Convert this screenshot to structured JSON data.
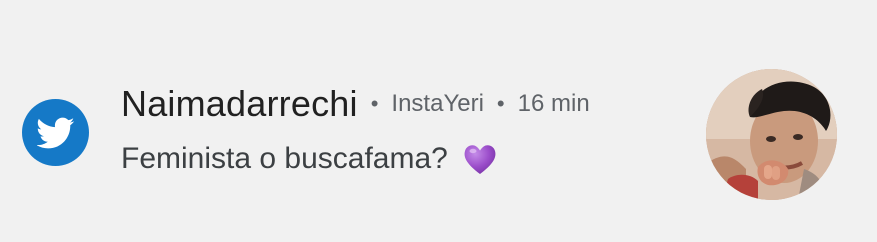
{
  "notification": {
    "app_icon": "twitter-bird-icon",
    "sender": "Naimadarrechi",
    "separator": "•",
    "account": "InstaYeri",
    "time": "16 min",
    "message": "Feminista o buscafama?",
    "emoji": "purple-heart-icon",
    "avatar": "profile-photo"
  },
  "colors": {
    "background": "#f1f1f1",
    "twitter_blue": "#1579c7",
    "sender_text": "#212121",
    "meta_text": "#5f6368",
    "message_text": "#3c4043",
    "heart_purple": "#9b4dca"
  }
}
